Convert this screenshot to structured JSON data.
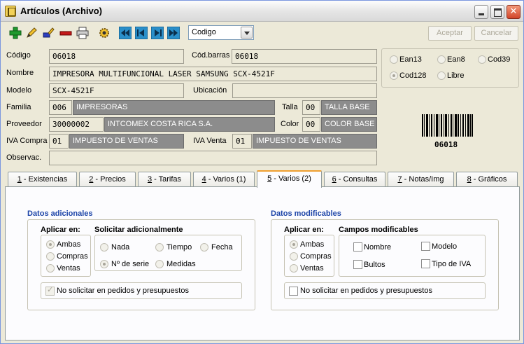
{
  "window": {
    "title": "Artículos (Archivo)"
  },
  "toolbar": {
    "combo_value": "Codigo",
    "accept_label": "Aceptar",
    "cancel_label": "Cancelar"
  },
  "form": {
    "codigo_label": "Código",
    "codigo_value": "06018",
    "codbarras_label": "Cód.barras",
    "codbarras_value": "06018",
    "nombre_label": "Nombre",
    "nombre_value": "IMPRESORA MULTIFUNCIONAL LASER SAMSUNG SCX-4521F",
    "modelo_label": "Modelo",
    "modelo_value": "SCX-4521F",
    "ubicacion_label": "Ubicación",
    "ubicacion_value": "",
    "familia_label": "Familia",
    "familia_code": "006",
    "familia_name": "IMPRESORAS",
    "talla_label": "Talla",
    "talla_code": "00",
    "talla_name": "TALLA BASE",
    "proveedor_label": "Proveedor",
    "proveedor_code": "30000002",
    "proveedor_name": "INTCOMEX COSTA RICA S.A.",
    "color_label": "Color",
    "color_code": "00",
    "color_name": "COLOR BASE",
    "iva_compra_label": "IVA Compra",
    "iva_compra_code": "01",
    "iva_compra_name": "IMPUESTO DE VENTAS",
    "iva_venta_label": "IVA Venta",
    "iva_venta_code": "01",
    "iva_venta_name": "IMPUESTO DE VENTAS",
    "observac_label": "Observac.",
    "observac_value": ""
  },
  "barcode": {
    "options": [
      "Ean13",
      "Ean8",
      "Cod39",
      "Cod128",
      "Libre"
    ],
    "selected": "Cod128",
    "text": "06018"
  },
  "tabs": [
    {
      "num": "1",
      "label": " - Existencias"
    },
    {
      "num": "2",
      "label": " - Precios"
    },
    {
      "num": "3",
      "label": " - Tarifas"
    },
    {
      "num": "4",
      "label": " - Varios (1)"
    },
    {
      "num": "5",
      "label": " - Varios (2)"
    },
    {
      "num": "6",
      "label": " - Consultas"
    },
    {
      "num": "7",
      "label": " - Notas/Img"
    },
    {
      "num": "8",
      "label": " - Gráficos"
    }
  ],
  "left_group": {
    "title": "Datos adicionales",
    "aplicar_title": "Aplicar en:",
    "aplicar_options": [
      "Ambas",
      "Compras",
      "Ventas"
    ],
    "solicitar_title": "Solicitar adicionalmente",
    "solicitar_options": [
      "Nada",
      "Tiempo",
      "Fecha",
      "Nº de serie",
      "Medidas"
    ],
    "no_solicitar_label": "No solicitar en pedidos y presupuestos"
  },
  "right_group": {
    "title": "Datos modificables",
    "aplicar_title": "Aplicar en:",
    "aplicar_options": [
      "Ambas",
      "Compras",
      "Ventas"
    ],
    "campos_title": "Campos modificables",
    "campos_options": [
      "Nombre",
      "Modelo",
      "Bultos",
      "Tipo de IVA"
    ],
    "no_solicitar_label": "No solicitar en pedidos y presupuestos"
  }
}
